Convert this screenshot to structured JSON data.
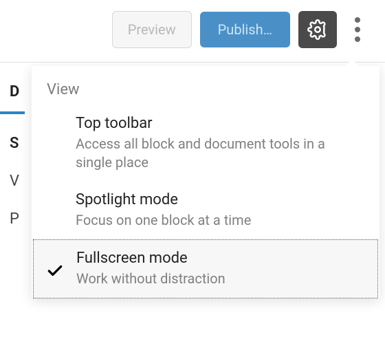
{
  "toolbar": {
    "preview_label": "Preview",
    "publish_label": "Publish…",
    "settings_icon": "gear-icon",
    "more_icon": "more-vertical-icon"
  },
  "sidebar": {
    "active_tab_label": "D",
    "rows": [
      "S",
      "V",
      "P"
    ]
  },
  "dropdown": {
    "section_label": "View",
    "items": [
      {
        "title": "Top toolbar",
        "desc": "Access all block and document tools in a single place",
        "selected": false
      },
      {
        "title": "Spotlight mode",
        "desc": "Focus on one block at a time",
        "selected": false
      },
      {
        "title": "Fullscreen mode",
        "desc": "Work without distraction",
        "selected": true
      }
    ]
  }
}
